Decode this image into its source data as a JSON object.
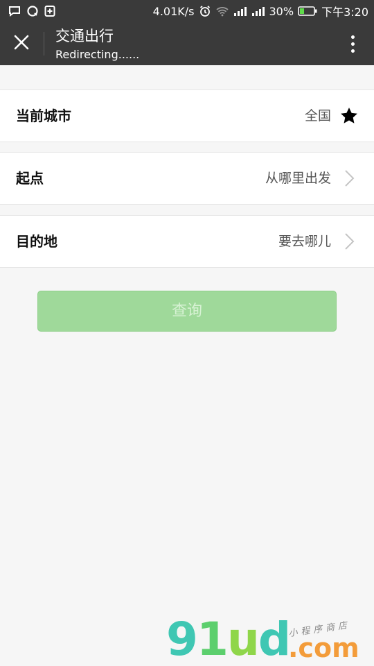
{
  "status_bar": {
    "network_speed": "4.01K/s",
    "battery": "30%",
    "time": "下午3:20",
    "icons": [
      "message-icon",
      "qq-icon",
      "plus-box-icon",
      "alarm-icon",
      "wifi-icon",
      "signal-icon",
      "signal-icon",
      "battery-icon"
    ]
  },
  "nav": {
    "title": "交通出行",
    "subtitle": "Redirecting......",
    "close_icon": "close-icon",
    "more_icon": "more-vertical-icon"
  },
  "rows": [
    {
      "label": "当前城市",
      "value": "全国",
      "icon": "star-icon"
    },
    {
      "label": "起点",
      "value": "从哪里出发",
      "icon": "chevron-right-icon"
    },
    {
      "label": "目的地",
      "value": "要去哪儿",
      "icon": "chevron-right-icon"
    }
  ],
  "query_button": {
    "label": "查询"
  },
  "watermark": {
    "brand_big": "91ud",
    "brand_com": ".com",
    "tagline": "小程序商店"
  },
  "colors": {
    "bar_bg": "#3a3a3a",
    "page_bg": "#f6f6f6",
    "button_bg": "#9fd99a",
    "button_text": "#d7f2d4",
    "watermark_teal": "#3fc7b3",
    "watermark_orange": "#f39c3a"
  }
}
